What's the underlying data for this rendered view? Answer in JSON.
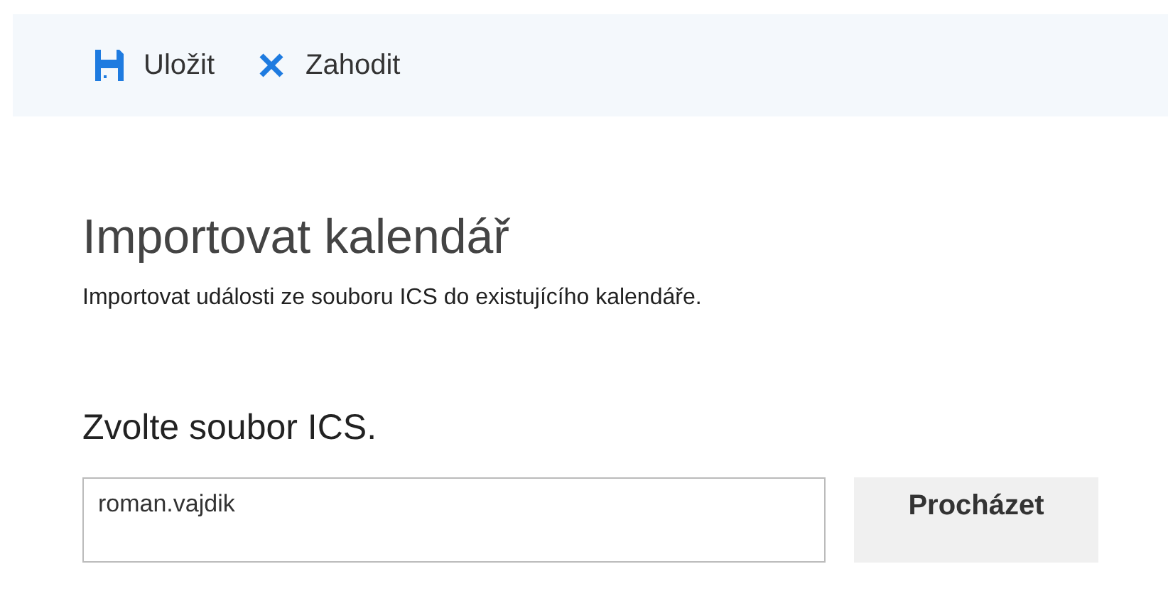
{
  "toolbar": {
    "buttons": [
      {
        "kind": "save",
        "label": "Uložit"
      },
      {
        "kind": "discard",
        "label": "Zahodit"
      }
    ]
  },
  "title": "Importovat kalendář",
  "description": "Importovat události ze souboru ICS do existujícího kalendáře.",
  "file_section": {
    "heading": "Zvolte soubor ICS.",
    "file_field": {
      "value": "roman.vajdik"
    },
    "browse_button": "Procházet"
  }
}
